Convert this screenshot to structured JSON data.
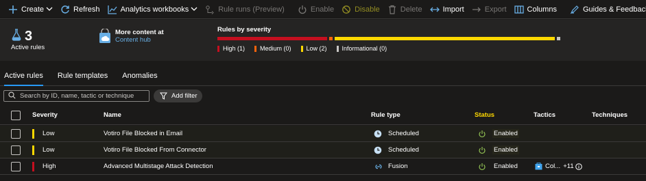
{
  "toolbar": {
    "create": "Create",
    "refresh": "Refresh",
    "analytics": "Analytics workbooks",
    "rule_runs": "Rule runs (Preview)",
    "enable": "Enable",
    "disable": "Disable",
    "delete": "Delete",
    "import": "Import",
    "export": "Export",
    "columns": "Columns",
    "guides": "Guides & Feedback"
  },
  "summary": {
    "active_count": "3",
    "active_label": "Active rules",
    "hub_title": "More content at",
    "hub_link": "Content hub",
    "severity_title": "Rules by severity",
    "severity_counts": {
      "high": 1,
      "medium": 0,
      "low": 2,
      "informational": 0
    },
    "legend": [
      "High (1)",
      "Medium (0)",
      "Low (2)",
      "Informational (0)"
    ]
  },
  "tabs": [
    "Active rules",
    "Rule templates",
    "Anomalies"
  ],
  "search": {
    "placeholder": "Search by ID, name, tactic or technique"
  },
  "add_filter": "Add filter",
  "table": {
    "headers": {
      "severity": "Severity",
      "name": "Name",
      "rule_type": "Rule type",
      "status": "Status",
      "tactics": "Tactics",
      "techniques": "Techniques"
    },
    "rows": [
      {
        "severity": "Low",
        "name": "Votiro File Blocked in Email",
        "rule_type": "Scheduled",
        "status": "Enabled",
        "tactics": "",
        "more": ""
      },
      {
        "severity": "Low",
        "name": "Votiro File Blocked From Connector",
        "rule_type": "Scheduled",
        "status": "Enabled",
        "tactics": "",
        "more": ""
      },
      {
        "severity": "High",
        "name": "Advanced Multistage Attack Detection",
        "rule_type": "Fusion",
        "status": "Enabled",
        "tactics": "Col...",
        "more": "+11"
      }
    ]
  },
  "colors": {
    "high": "#c50f1f",
    "medium": "#f7630c",
    "low": "#ffd800",
    "informational": "#c8c6c4",
    "accent": "#2899f5",
    "status_header": "#ffd800",
    "status_ok": "#92c353"
  },
  "icons": [
    "plus-icon",
    "refresh-icon",
    "chart-icon",
    "rule-runs-icon",
    "power-icon",
    "disable-icon",
    "trash-icon",
    "import-icon",
    "export-icon",
    "columns-icon",
    "feedback-icon",
    "flask-icon",
    "shopping-bag-icon",
    "search-icon",
    "filter-icon",
    "clock-icon",
    "fusion-icon",
    "tactic-icon",
    "info-icon"
  ]
}
